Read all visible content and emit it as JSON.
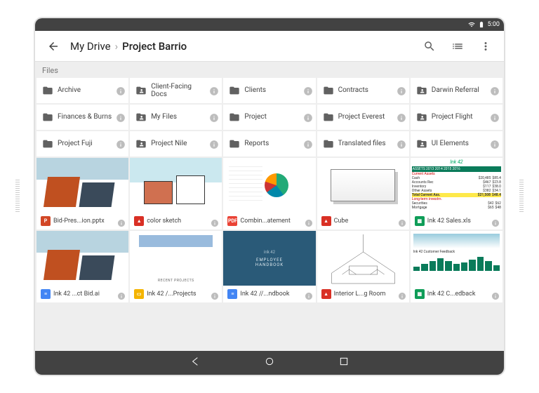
{
  "statusbar": {
    "time": "5:00"
  },
  "toolbar": {
    "breadcrumb_root": "My Drive",
    "breadcrumb_current": "Project Barrio"
  },
  "section_label": "Files",
  "folders": [
    {
      "name": "Archive",
      "shared": false
    },
    {
      "name": "Client-Facing Docs",
      "shared": true
    },
    {
      "name": "Clients",
      "shared": false
    },
    {
      "name": "Contracts",
      "shared": false
    },
    {
      "name": "Darwin Referral",
      "shared": true
    },
    {
      "name": "Finances & Burns",
      "shared": false
    },
    {
      "name": "My Files",
      "shared": true
    },
    {
      "name": "Project",
      "shared": false
    },
    {
      "name": "Project Everest",
      "shared": false
    },
    {
      "name": "Project Flight",
      "shared": true
    },
    {
      "name": "Project Fuji",
      "shared": false
    },
    {
      "name": "Project Nile",
      "shared": true
    },
    {
      "name": "Reports",
      "shared": false
    },
    {
      "name": "Translated files",
      "shared": false
    },
    {
      "name": "UI Elements",
      "shared": true
    }
  ],
  "files": [
    {
      "name": "Bid-Pres...ion.pptx",
      "type": "pptx",
      "thumb": "arch1"
    },
    {
      "name": "color sketch",
      "type": "image",
      "thumb": "sketch"
    },
    {
      "name": "Combin...atement",
      "type": "pdf",
      "thumb": "pie"
    },
    {
      "name": "Cube",
      "type": "image",
      "thumb": "cube"
    },
    {
      "name": "Ink 42 Sales.xls",
      "type": "sheets",
      "thumb": "sales"
    },
    {
      "name": "Ink 42 ...ct Bid.ai",
      "type": "docs",
      "thumb": "arch1"
    },
    {
      "name": "Ink 42 /...Projects",
      "type": "slides",
      "thumb": "arch3"
    },
    {
      "name": "Ink 42 //...ndbook",
      "type": "docs",
      "thumb": "handbook"
    },
    {
      "name": "Interior L...g Room",
      "type": "image",
      "thumb": "room"
    },
    {
      "name": "Ink 42 C...edback",
      "type": "sheets",
      "thumb": "feedback"
    }
  ],
  "file_type_colors": {
    "pptx": "#d24726",
    "image": "#d93025",
    "pdf": "#ea4335",
    "sheets": "#0f9d58",
    "docs": "#4285f4",
    "slides": "#f4b400"
  },
  "file_type_glyphs": {
    "pptx": "P",
    "image": "▲",
    "pdf": "PDF",
    "sheets": "▦",
    "docs": "≡",
    "slides": "▭"
  },
  "sales_thumb": {
    "title": "Ink 42",
    "header": "ASSETS    2013 2014 2015 2016",
    "section": "Current Assets",
    "rows": [
      [
        "Cash",
        "$20,485",
        "$85.4"
      ],
      [
        "Accounts Rec",
        "$467",
        "$23.8"
      ],
      [
        "Inventory",
        "$117",
        "$38.0"
      ],
      [
        "Other Assets",
        "$382",
        "$34.1"
      ]
    ],
    "total": [
      "Total Current Ass.",
      "$21,508",
      "$48.4"
    ],
    "section2": "Long-term investm.",
    "rows2": [
      [
        "Securities",
        "$42",
        "$62"
      ],
      [
        "Mortgage",
        "$65",
        "$48"
      ]
    ]
  },
  "handbook_thumb": {
    "logo": "ink 42",
    "line1": "EMPLOYEE",
    "line2": "HANDBOOK"
  },
  "feedback_thumb": {
    "title": "Ink 42 Customer Feedback"
  }
}
